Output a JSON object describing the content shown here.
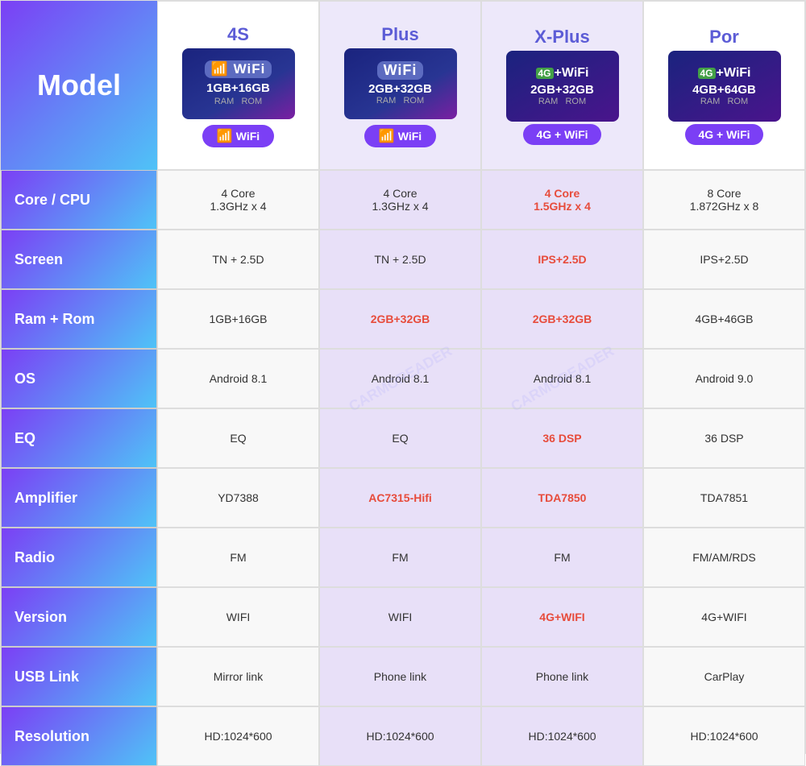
{
  "table": {
    "model_label": "Model",
    "columns": [
      {
        "id": "4s",
        "name": "4S",
        "name_color": "blue",
        "connectivity_label": "WiFi",
        "connectivity_type": "wifi",
        "ram_rom": "1GB+16GB",
        "ram_label": "RAM",
        "rom_label": "ROM"
      },
      {
        "id": "plus",
        "name": "Plus",
        "name_color": "blue",
        "connectivity_label": "WiFi",
        "connectivity_type": "wifi",
        "ram_rom": "2GB+32GB",
        "ram_label": "RAM",
        "rom_label": "ROM"
      },
      {
        "id": "xplus",
        "name": "X-Plus",
        "name_color": "blue",
        "connectivity_label": "4G + WiFi",
        "connectivity_type": "4gwifi",
        "ram_rom": "2GB+32GB",
        "ram_label": "RAM",
        "rom_label": "ROM"
      },
      {
        "id": "por",
        "name": "Por",
        "name_color": "blue",
        "connectivity_label": "4G + WiFi",
        "connectivity_type": "4gwifi",
        "ram_rom": "4GB+64GB",
        "ram_label": "RAM",
        "rom_label": "ROM"
      }
    ],
    "rows": [
      {
        "label": "Core / CPU",
        "values": [
          {
            "text": "4 Core\n1.3GHz x 4",
            "style": "normal"
          },
          {
            "text": "4 Core\n1.3GHz x 4",
            "style": "normal"
          },
          {
            "text": "4 Core\n1.5GHz x 4",
            "style": "red"
          },
          {
            "text": "8 Core\n1.872GHz x 8",
            "style": "normal"
          }
        ]
      },
      {
        "label": "Screen",
        "values": [
          {
            "text": "TN + 2.5D",
            "style": "normal"
          },
          {
            "text": "TN + 2.5D",
            "style": "normal"
          },
          {
            "text": "IPS+2.5D",
            "style": "red"
          },
          {
            "text": "IPS+2.5D",
            "style": "normal"
          }
        ]
      },
      {
        "label": "Ram + Rom",
        "values": [
          {
            "text": "1GB+16GB",
            "style": "normal"
          },
          {
            "text": "2GB+32GB",
            "style": "red"
          },
          {
            "text": "2GB+32GB",
            "style": "red"
          },
          {
            "text": "4GB+46GB",
            "style": "normal"
          }
        ]
      },
      {
        "label": "OS",
        "values": [
          {
            "text": "Android 8.1",
            "style": "normal"
          },
          {
            "text": "Android 8.1",
            "style": "normal"
          },
          {
            "text": "Android 8.1",
            "style": "normal"
          },
          {
            "text": "Android 9.0",
            "style": "normal"
          }
        ]
      },
      {
        "label": "EQ",
        "values": [
          {
            "text": "EQ",
            "style": "normal"
          },
          {
            "text": "EQ",
            "style": "normal"
          },
          {
            "text": "36 DSP",
            "style": "red"
          },
          {
            "text": "36 DSP",
            "style": "normal"
          }
        ]
      },
      {
        "label": "Amplifier",
        "values": [
          {
            "text": "YD7388",
            "style": "normal"
          },
          {
            "text": "AC7315-Hifi",
            "style": "red"
          },
          {
            "text": "TDA7850",
            "style": "red"
          },
          {
            "text": "TDA7851",
            "style": "normal"
          }
        ]
      },
      {
        "label": "Radio",
        "values": [
          {
            "text": "FM",
            "style": "normal"
          },
          {
            "text": "FM",
            "style": "normal"
          },
          {
            "text": "FM",
            "style": "normal"
          },
          {
            "text": "FM/AM/RDS",
            "style": "normal"
          }
        ]
      },
      {
        "label": "Version",
        "values": [
          {
            "text": "WIFI",
            "style": "normal"
          },
          {
            "text": "WIFI",
            "style": "normal"
          },
          {
            "text": "4G+WIFI",
            "style": "red"
          },
          {
            "text": "4G+WIFI",
            "style": "normal"
          }
        ]
      },
      {
        "label": "USB Link",
        "values": [
          {
            "text": "Mirror link",
            "style": "normal"
          },
          {
            "text": "Phone link",
            "style": "normal"
          },
          {
            "text": "Phone link",
            "style": "normal"
          },
          {
            "text": "CarPlay",
            "style": "normal"
          }
        ]
      },
      {
        "label": "Resolution",
        "values": [
          {
            "text": "HD:1024*600",
            "style": "normal"
          },
          {
            "text": "HD:1024*600",
            "style": "normal"
          },
          {
            "text": "HD:1024*600",
            "style": "normal"
          },
          {
            "text": "HD:1024*600",
            "style": "normal"
          }
        ]
      }
    ]
  }
}
